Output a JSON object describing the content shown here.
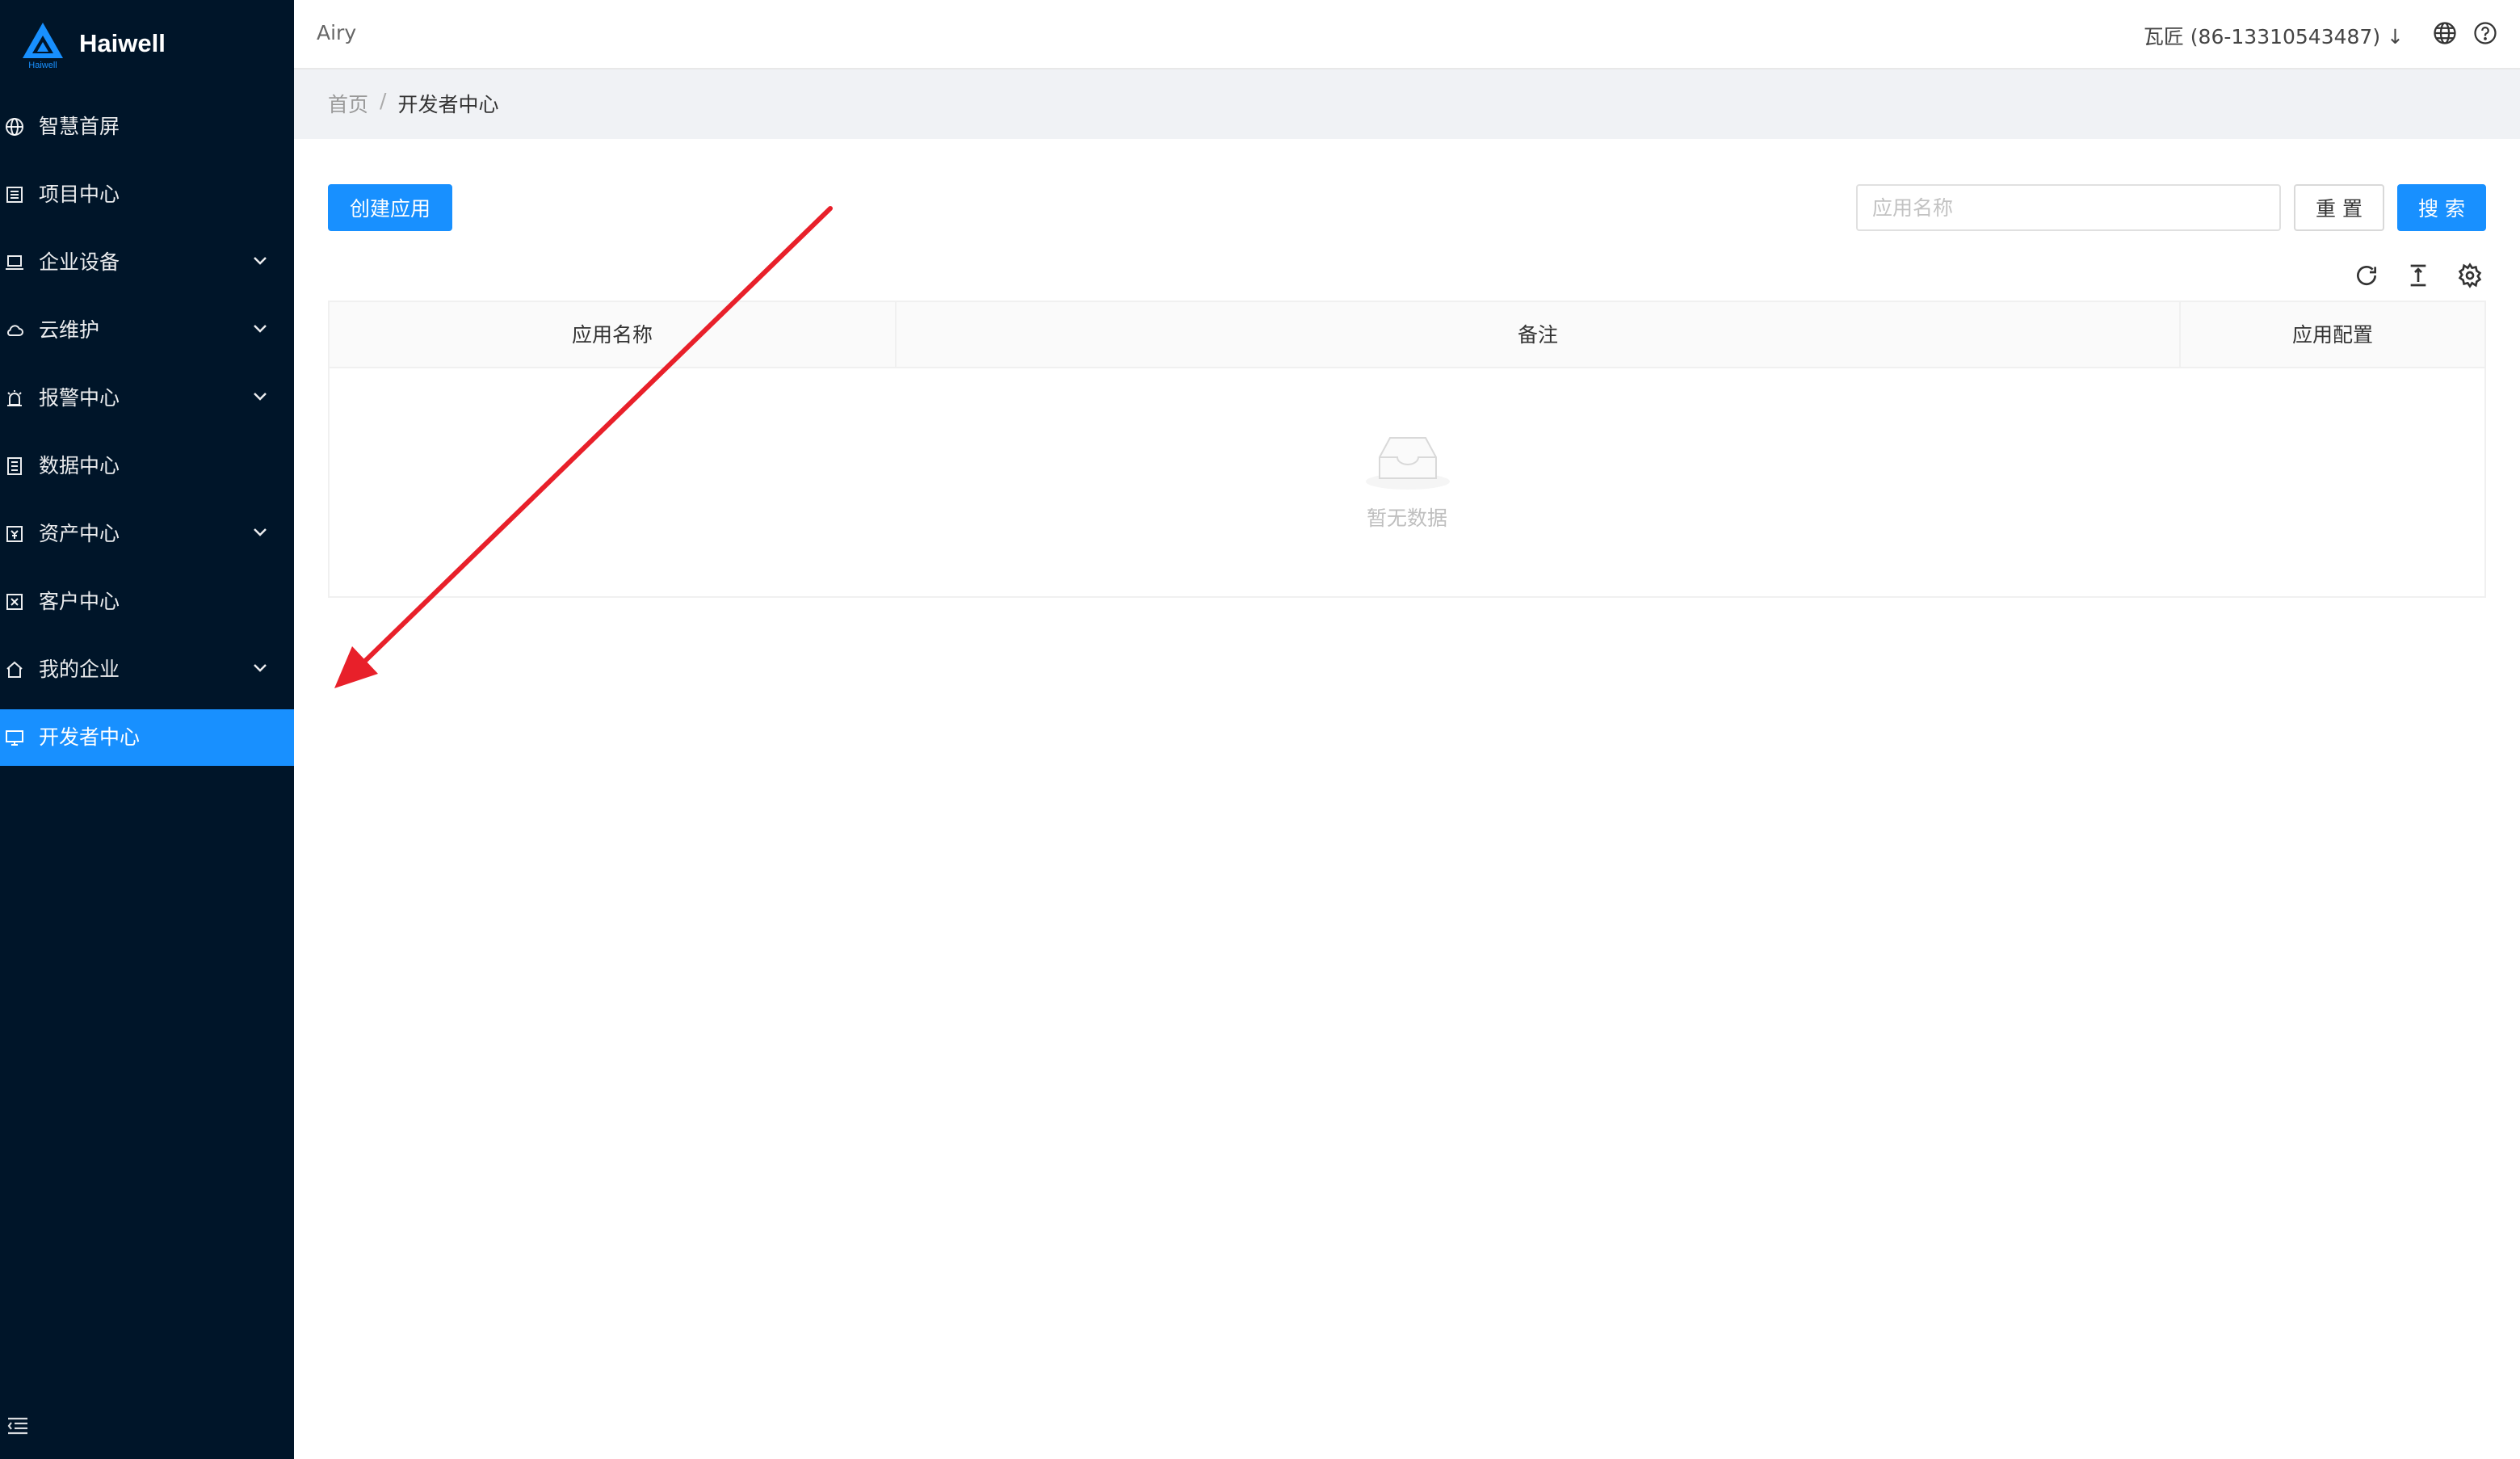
{
  "brand": {
    "name": "Haiwell",
    "logo_small": "Haiwell",
    "color": "#1890ff"
  },
  "sidebar": {
    "items": [
      {
        "label": "智慧首屏",
        "icon": "globe-icon",
        "has_submenu": false,
        "active": false
      },
      {
        "label": "项目中心",
        "icon": "list-icon",
        "has_submenu": false,
        "active": false
      },
      {
        "label": "企业设备",
        "icon": "laptop-icon",
        "has_submenu": true,
        "active": false
      },
      {
        "label": "云维护",
        "icon": "cloud-icon",
        "has_submenu": true,
        "active": false
      },
      {
        "label": "报警中心",
        "icon": "alarm-icon",
        "has_submenu": true,
        "active": false
      },
      {
        "label": "数据中心",
        "icon": "database-icon",
        "has_submenu": false,
        "active": false
      },
      {
        "label": "资产中心",
        "icon": "asset-icon",
        "has_submenu": true,
        "active": false
      },
      {
        "label": "客户中心",
        "icon": "customer-icon",
        "has_submenu": false,
        "active": false
      },
      {
        "label": "我的企业",
        "icon": "home-icon",
        "has_submenu": true,
        "active": false
      },
      {
        "label": "开发者中心",
        "icon": "desktop-icon",
        "has_submenu": false,
        "active": true
      }
    ],
    "collapse_icon": "menu-fold-icon",
    "background": "#001529",
    "active_color": "#1890ff"
  },
  "header": {
    "tenant": "Airy",
    "user": "瓦匠 (86-13310543487) ↓",
    "icons": [
      "globe-icon",
      "help-icon"
    ]
  },
  "breadcrumb": {
    "home": "首页",
    "separator": "/",
    "current": "开发者中心"
  },
  "toolbar": {
    "create_label": "创建应用",
    "search_placeholder": "应用名称",
    "search_value": "",
    "reset_label": "重 置",
    "search_label": "搜 索",
    "table_tools": [
      "refresh-icon",
      "column-height-icon",
      "setting-icon"
    ]
  },
  "table": {
    "columns": [
      "应用名称",
      "备注",
      "应用配置"
    ],
    "rows": [],
    "empty_text": "暂无数据"
  },
  "annotation": {
    "type": "arrow",
    "color": "#e8202a"
  }
}
